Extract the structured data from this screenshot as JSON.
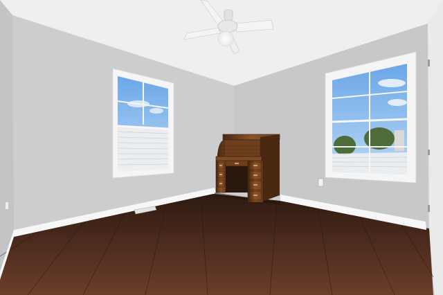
{
  "colors": {
    "ceiling": "#eeefef",
    "wall_left": "#c2c4c6",
    "wall_back": "#cbcdcf",
    "wall_right": "#c6c8ca",
    "baseboard": "#f7f7f7",
    "floor_dark": "#2e1a12",
    "floor_mid": "#4a2a1c",
    "floor_light": "#6a3f2a",
    "window_frame": "#f5f5f5",
    "sky": "#6aa7e8",
    "sky_light": "#b9d7f4",
    "wood": "#6e3f1f",
    "wood_dark": "#4a2811",
    "wood_light": "#8a5429",
    "brass": "#c9a45a"
  }
}
